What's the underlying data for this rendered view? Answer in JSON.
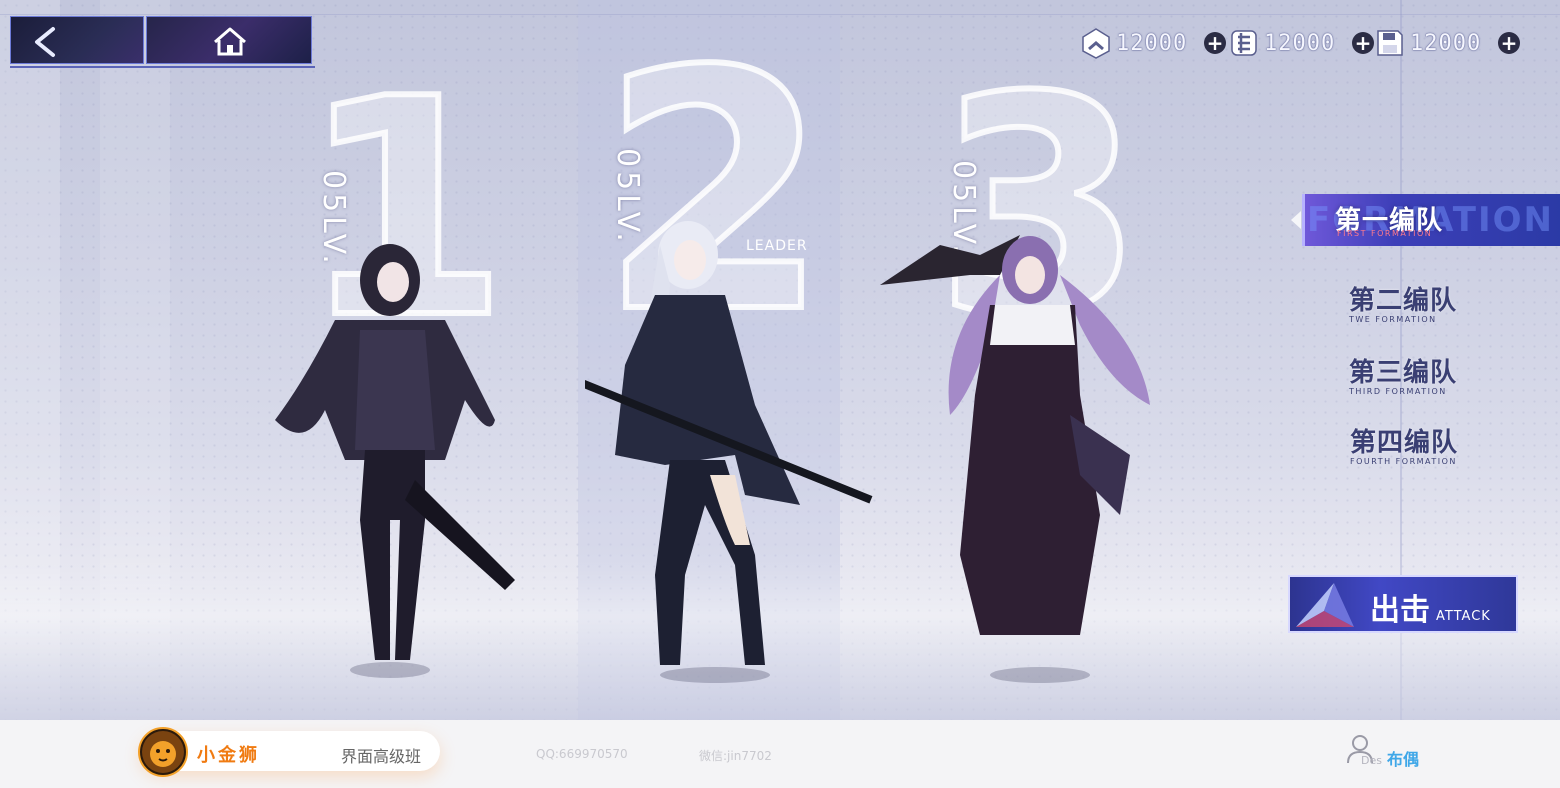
{
  "nav": {
    "back_icon": "chevron-left-icon",
    "home_icon": "home-icon"
  },
  "currencies": [
    {
      "icon": "rank-badge-icon",
      "value": "12000",
      "plus": "+"
    },
    {
      "icon": "gear-token-icon",
      "value": "12000",
      "plus": "+"
    },
    {
      "icon": "floppy-disk-icon",
      "value": "12000",
      "plus": "+"
    }
  ],
  "team": [
    {
      "slot": "1",
      "level": "05LV."
    },
    {
      "slot": "2",
      "level": "05LV.",
      "role": "LEADER"
    },
    {
      "slot": "3",
      "level": "05LV."
    }
  ],
  "formations": [
    {
      "cn": "第一编队",
      "en": "FIRST FORMATION",
      "ghost": "FORMATION",
      "active": true
    },
    {
      "cn": "第二编队",
      "en": "TWE FORMATION",
      "active": false
    },
    {
      "cn": "第三编队",
      "en": "THIRD FORMATION",
      "active": false
    },
    {
      "cn": "第四编队",
      "en": "FOURTH FORMATION",
      "active": false
    }
  ],
  "attack": {
    "cn": "出击",
    "en": "ATTACK"
  },
  "footer": {
    "brand": "小金狮",
    "course": "界面高级班",
    "qq": "QQ:669970570",
    "wechat": "微信:jin7702",
    "des": "Des",
    "author": "布偶"
  },
  "colors": {
    "accent": "#3d3fb8",
    "brand_orange": "#f07b12",
    "author_blue": "#3fa7e8"
  }
}
